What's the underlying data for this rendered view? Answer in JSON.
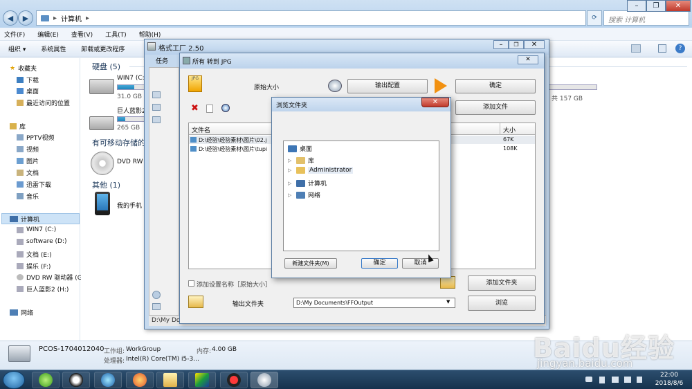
{
  "explorer": {
    "address": "计算机",
    "search_placeholder": "搜索 计算机",
    "menu": [
      "文件(F)",
      "编辑(E)",
      "查看(V)",
      "工具(T)",
      "帮助(H)"
    ],
    "toolbar": [
      "组织 ▾",
      "系统属性",
      "卸载或更改程序"
    ],
    "nav": {
      "favorites": "收藏夹",
      "fav_items": [
        "下载",
        "桌面",
        "最近访问的位置"
      ],
      "library": "库",
      "lib_items": [
        "PPTV视频",
        "视频",
        "图片",
        "文档",
        "迅雷下载",
        "音乐"
      ],
      "computer": "计算机",
      "comp_items": [
        "WIN7 (C:)",
        "software (D:)",
        "文档 (E:)",
        "娱乐 (F:)",
        "DVD RW 驱动器 (G",
        "巨人蓝影2 (H:)"
      ],
      "network": "网络"
    },
    "content": {
      "hdd_header": "硬盘 (5)",
      "drives": [
        {
          "name": "WIN7 (C:)",
          "free": "31.0 GB",
          "fill": 0.62
        },
        {
          "name": "巨人蓝影2",
          "free": "265 GB",
          "fill": 0.3
        }
      ],
      "right_drive_free": "B 共 157 GB",
      "right_drive_fill": 0.05,
      "removable_header": "有可移动存储的",
      "dvd": "DVD RW",
      "other_header": "其他 (1)",
      "phone": "我的手机"
    },
    "details": {
      "pc_name": "PCOS-1704012040",
      "workgroup_label": "工作组:",
      "workgroup": "WorkGroup",
      "memory_label": "内存:",
      "memory": "4.00 GB",
      "cpu_label": "处理器:",
      "cpu": "Intel(R) Core(TM) i5-3..."
    }
  },
  "formatfactory": {
    "title": "格式工厂 2.50",
    "menu_task": "任务",
    "status": "D:\\My Documents\\FFOutput"
  },
  "convert": {
    "title": "所有 转到 JPG",
    "original_size": "原始大小",
    "output_config": "输出配置",
    "ok": "确定",
    "add_file": "添加文件",
    "col_filename": "文件名",
    "col_size": "大小",
    "files": [
      {
        "path": "D:\\经验\\经验素材\\图片\\02.j",
        "size": "67K"
      },
      {
        "path": "D:\\经验\\经验素材\\图片\\tupi",
        "size": "108K"
      }
    ],
    "add_setting_name": "添加设置名称［原始大小］",
    "add_folder": "添加文件夹",
    "output_folder_label": "输出文件夹",
    "output_folder": "D:\\My Documents\\FFOutput",
    "browse": "浏览"
  },
  "browse_folder": {
    "title": "浏览文件夹",
    "close": "✕",
    "tree": [
      "桌面",
      "库",
      "Administrator",
      "计算机",
      "网络"
    ],
    "new_folder": "新建文件夹(M)",
    "ok": "确定",
    "cancel": "取消"
  },
  "taskbar": {
    "time": "22:00",
    "date": "2018/8/6"
  },
  "watermark": {
    "logo": "Baidu经验",
    "url": "jingyan.baidu.com"
  },
  "colors": {
    "accent": "#1e86bd",
    "taskbar": "#1c3a57",
    "close_red": "#c0392b"
  }
}
